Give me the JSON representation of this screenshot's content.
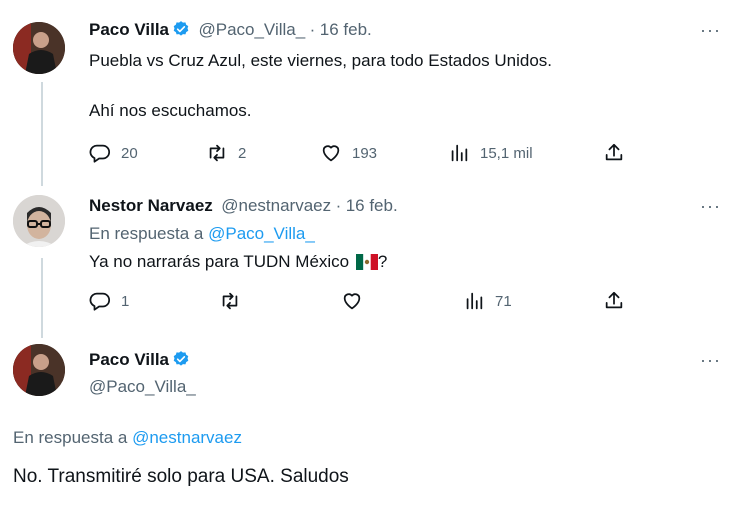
{
  "tweets": [
    {
      "name": "Paco Villa",
      "handle": "@Paco_Villa_",
      "separator": "·",
      "date": "16 feb.",
      "line1": "Puebla vs Cruz Azul, este viernes, para todo Estados Unidos.",
      "line2": "Ahí nos escuchamos.",
      "replies": "20",
      "retweets": "2",
      "likes": "193",
      "views": "15,1 mil",
      "more": "···"
    },
    {
      "name": "Nestor Narvaez",
      "handle": "@nestnarvaez",
      "separator": "·",
      "date": "16 feb.",
      "reply_prefix": "En respuesta a",
      "reply_to": "@Paco_Villa_",
      "text": "Ya no narrarás para TUDN México",
      "text_end": "?",
      "replies": "1",
      "views": "71",
      "more": "···"
    },
    {
      "name": "Paco Villa",
      "handle": "@Paco_Villa_",
      "reply_prefix": "En respuesta a",
      "reply_to": "@nestnarvaez",
      "text": "No. Transmitiré solo para USA. Saludos",
      "more": "···"
    }
  ],
  "colors": {
    "verified": "#1d9bf0",
    "link": "#1d9bf0",
    "muted": "#536471",
    "flag_green": "#006847",
    "flag_red": "#ce1126"
  }
}
